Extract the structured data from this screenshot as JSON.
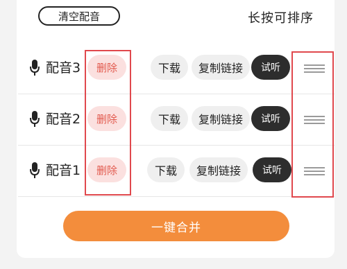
{
  "header": {
    "clear_label": "清空配音",
    "sort_hint": "长按可排序"
  },
  "dubs": [
    {
      "name": "配音3",
      "delete_label": "删除",
      "download_label": "下载",
      "copy_label": "复制链接",
      "listen_label": "试听"
    },
    {
      "name": "配音2",
      "delete_label": "删除",
      "download_label": "下载",
      "copy_label": "复制链接",
      "listen_label": "试听"
    },
    {
      "name": "配音1",
      "delete_label": "删除",
      "download_label": "下载",
      "copy_label": "复制链接",
      "listen_label": "试听"
    }
  ],
  "footer": {
    "merge_label": "一键合并"
  },
  "icons": {
    "mic": "microphone-icon",
    "drag": "drag-handle-icon"
  },
  "colors": {
    "accent_orange": "#f38d3c",
    "delete_red": "#e25a4e",
    "delete_bg": "#fbe0df",
    "listen_dark": "#2d2d2d",
    "highlight_red": "#e0484d"
  }
}
